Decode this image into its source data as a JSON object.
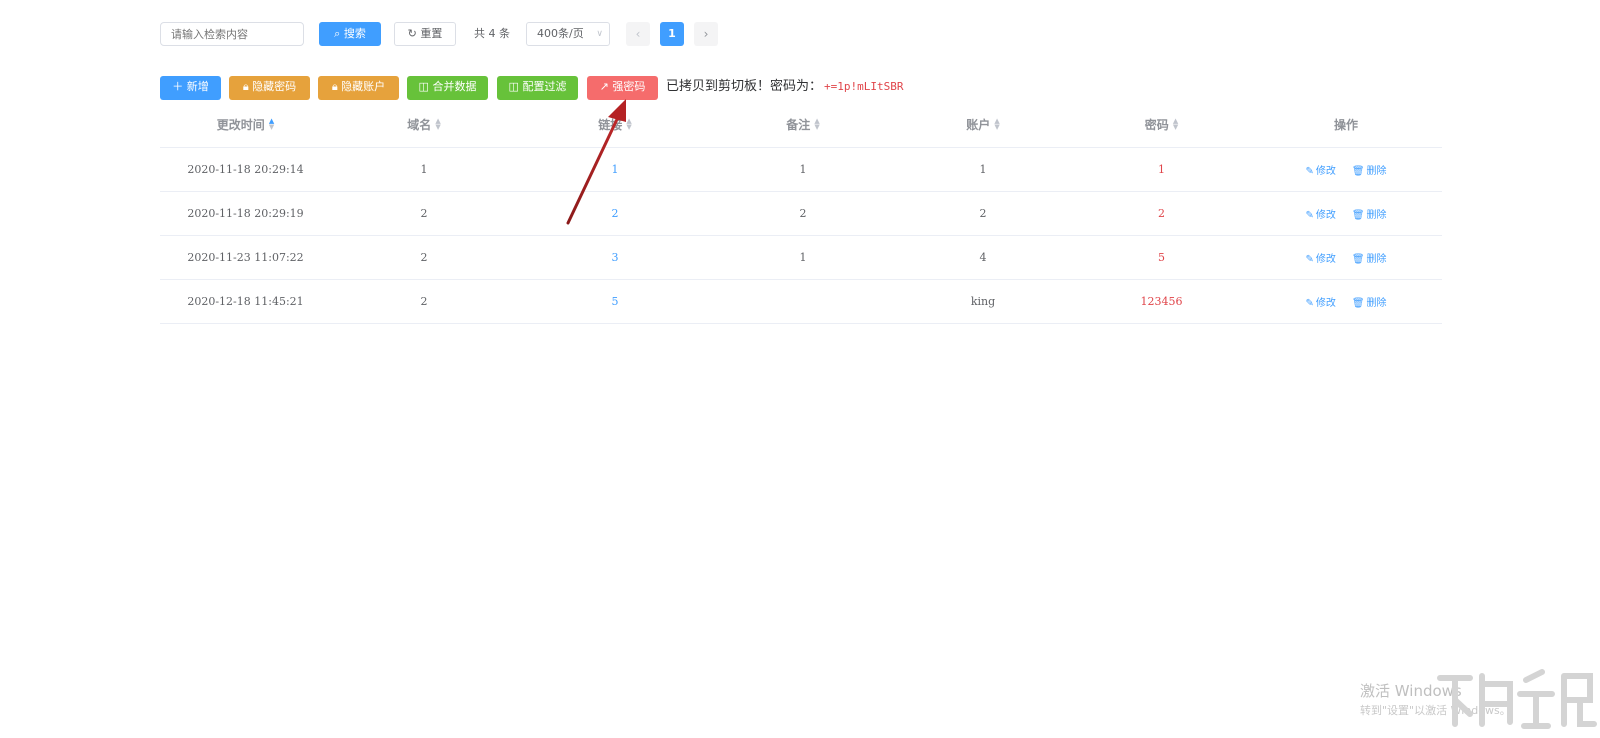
{
  "search": {
    "placeholder": "请输入检索内容",
    "search_label": "搜索",
    "search_icon": "search-icon",
    "reset_label": "重置",
    "reset_icon": "refresh-icon"
  },
  "pagination": {
    "total_text": "共 4 条",
    "page_size": "400条/页",
    "prev": "‹",
    "current_page": "1",
    "next": "›"
  },
  "toolbar": {
    "add_label": "新增",
    "hide_password_label": "隐藏密码",
    "hide_account_label": "隐藏账户",
    "merge_label": "合并数据",
    "filter_label": "配置过滤",
    "generate_label": "强密码",
    "message_text": "已拷贝到剪切板！密码为：",
    "message_password": "+=1p!mLItSBR",
    "colors": {
      "primary": "#409eff",
      "warning": "#e6a23c",
      "success": "#67c23a",
      "danger": "#f56c6c"
    }
  },
  "table": {
    "columns": [
      "更改时间",
      "域名",
      "链接",
      "备注",
      "账户",
      "密码",
      "操作"
    ],
    "rows": [
      {
        "time": "2020-11-18 20:29:14",
        "domain": "1",
        "link": "1",
        "note": "1",
        "account": "1",
        "password": "1"
      },
      {
        "time": "2020-11-18 20:29:19",
        "domain": "2",
        "link": "2",
        "note": "2",
        "account": "2",
        "password": "2"
      },
      {
        "time": "2020-11-23 11:07:22",
        "domain": "2",
        "link": "3",
        "note": "1",
        "account": "4",
        "password": "5"
      },
      {
        "time": "2020-12-18 11:45:21",
        "domain": "2",
        "link": "5",
        "note": "",
        "account": "king",
        "password": "123456"
      }
    ],
    "edit_label": "修改",
    "delete_label": "删除"
  },
  "watermark": {
    "line1": "激活 Windows",
    "line2": "转到\"设置\"以激活 Windows。"
  }
}
